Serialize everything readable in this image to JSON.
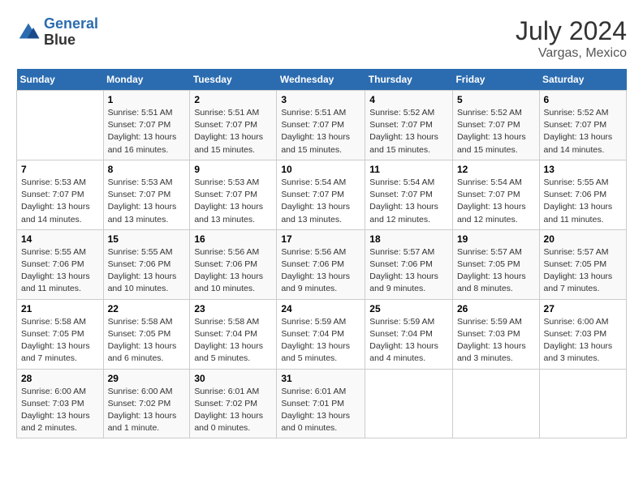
{
  "header": {
    "logo_line1": "General",
    "logo_line2": "Blue",
    "month_year": "July 2024",
    "location": "Vargas, Mexico"
  },
  "days_of_week": [
    "Sunday",
    "Monday",
    "Tuesday",
    "Wednesday",
    "Thursday",
    "Friday",
    "Saturday"
  ],
  "weeks": [
    [
      {
        "num": "",
        "info": ""
      },
      {
        "num": "1",
        "info": "Sunrise: 5:51 AM\nSunset: 7:07 PM\nDaylight: 13 hours\nand 16 minutes."
      },
      {
        "num": "2",
        "info": "Sunrise: 5:51 AM\nSunset: 7:07 PM\nDaylight: 13 hours\nand 15 minutes."
      },
      {
        "num": "3",
        "info": "Sunrise: 5:51 AM\nSunset: 7:07 PM\nDaylight: 13 hours\nand 15 minutes."
      },
      {
        "num": "4",
        "info": "Sunrise: 5:52 AM\nSunset: 7:07 PM\nDaylight: 13 hours\nand 15 minutes."
      },
      {
        "num": "5",
        "info": "Sunrise: 5:52 AM\nSunset: 7:07 PM\nDaylight: 13 hours\nand 15 minutes."
      },
      {
        "num": "6",
        "info": "Sunrise: 5:52 AM\nSunset: 7:07 PM\nDaylight: 13 hours\nand 14 minutes."
      }
    ],
    [
      {
        "num": "7",
        "info": "Sunrise: 5:53 AM\nSunset: 7:07 PM\nDaylight: 13 hours\nand 14 minutes."
      },
      {
        "num": "8",
        "info": "Sunrise: 5:53 AM\nSunset: 7:07 PM\nDaylight: 13 hours\nand 13 minutes."
      },
      {
        "num": "9",
        "info": "Sunrise: 5:53 AM\nSunset: 7:07 PM\nDaylight: 13 hours\nand 13 minutes."
      },
      {
        "num": "10",
        "info": "Sunrise: 5:54 AM\nSunset: 7:07 PM\nDaylight: 13 hours\nand 13 minutes."
      },
      {
        "num": "11",
        "info": "Sunrise: 5:54 AM\nSunset: 7:07 PM\nDaylight: 13 hours\nand 12 minutes."
      },
      {
        "num": "12",
        "info": "Sunrise: 5:54 AM\nSunset: 7:07 PM\nDaylight: 13 hours\nand 12 minutes."
      },
      {
        "num": "13",
        "info": "Sunrise: 5:55 AM\nSunset: 7:06 PM\nDaylight: 13 hours\nand 11 minutes."
      }
    ],
    [
      {
        "num": "14",
        "info": "Sunrise: 5:55 AM\nSunset: 7:06 PM\nDaylight: 13 hours\nand 11 minutes."
      },
      {
        "num": "15",
        "info": "Sunrise: 5:55 AM\nSunset: 7:06 PM\nDaylight: 13 hours\nand 10 minutes."
      },
      {
        "num": "16",
        "info": "Sunrise: 5:56 AM\nSunset: 7:06 PM\nDaylight: 13 hours\nand 10 minutes."
      },
      {
        "num": "17",
        "info": "Sunrise: 5:56 AM\nSunset: 7:06 PM\nDaylight: 13 hours\nand 9 minutes."
      },
      {
        "num": "18",
        "info": "Sunrise: 5:57 AM\nSunset: 7:06 PM\nDaylight: 13 hours\nand 9 minutes."
      },
      {
        "num": "19",
        "info": "Sunrise: 5:57 AM\nSunset: 7:05 PM\nDaylight: 13 hours\nand 8 minutes."
      },
      {
        "num": "20",
        "info": "Sunrise: 5:57 AM\nSunset: 7:05 PM\nDaylight: 13 hours\nand 7 minutes."
      }
    ],
    [
      {
        "num": "21",
        "info": "Sunrise: 5:58 AM\nSunset: 7:05 PM\nDaylight: 13 hours\nand 7 minutes."
      },
      {
        "num": "22",
        "info": "Sunrise: 5:58 AM\nSunset: 7:05 PM\nDaylight: 13 hours\nand 6 minutes."
      },
      {
        "num": "23",
        "info": "Sunrise: 5:58 AM\nSunset: 7:04 PM\nDaylight: 13 hours\nand 5 minutes."
      },
      {
        "num": "24",
        "info": "Sunrise: 5:59 AM\nSunset: 7:04 PM\nDaylight: 13 hours\nand 5 minutes."
      },
      {
        "num": "25",
        "info": "Sunrise: 5:59 AM\nSunset: 7:04 PM\nDaylight: 13 hours\nand 4 minutes."
      },
      {
        "num": "26",
        "info": "Sunrise: 5:59 AM\nSunset: 7:03 PM\nDaylight: 13 hours\nand 3 minutes."
      },
      {
        "num": "27",
        "info": "Sunrise: 6:00 AM\nSunset: 7:03 PM\nDaylight: 13 hours\nand 3 minutes."
      }
    ],
    [
      {
        "num": "28",
        "info": "Sunrise: 6:00 AM\nSunset: 7:03 PM\nDaylight: 13 hours\nand 2 minutes."
      },
      {
        "num": "29",
        "info": "Sunrise: 6:00 AM\nSunset: 7:02 PM\nDaylight: 13 hours\nand 1 minute."
      },
      {
        "num": "30",
        "info": "Sunrise: 6:01 AM\nSunset: 7:02 PM\nDaylight: 13 hours\nand 0 minutes."
      },
      {
        "num": "31",
        "info": "Sunrise: 6:01 AM\nSunset: 7:01 PM\nDaylight: 13 hours\nand 0 minutes."
      },
      {
        "num": "",
        "info": ""
      },
      {
        "num": "",
        "info": ""
      },
      {
        "num": "",
        "info": ""
      }
    ]
  ]
}
